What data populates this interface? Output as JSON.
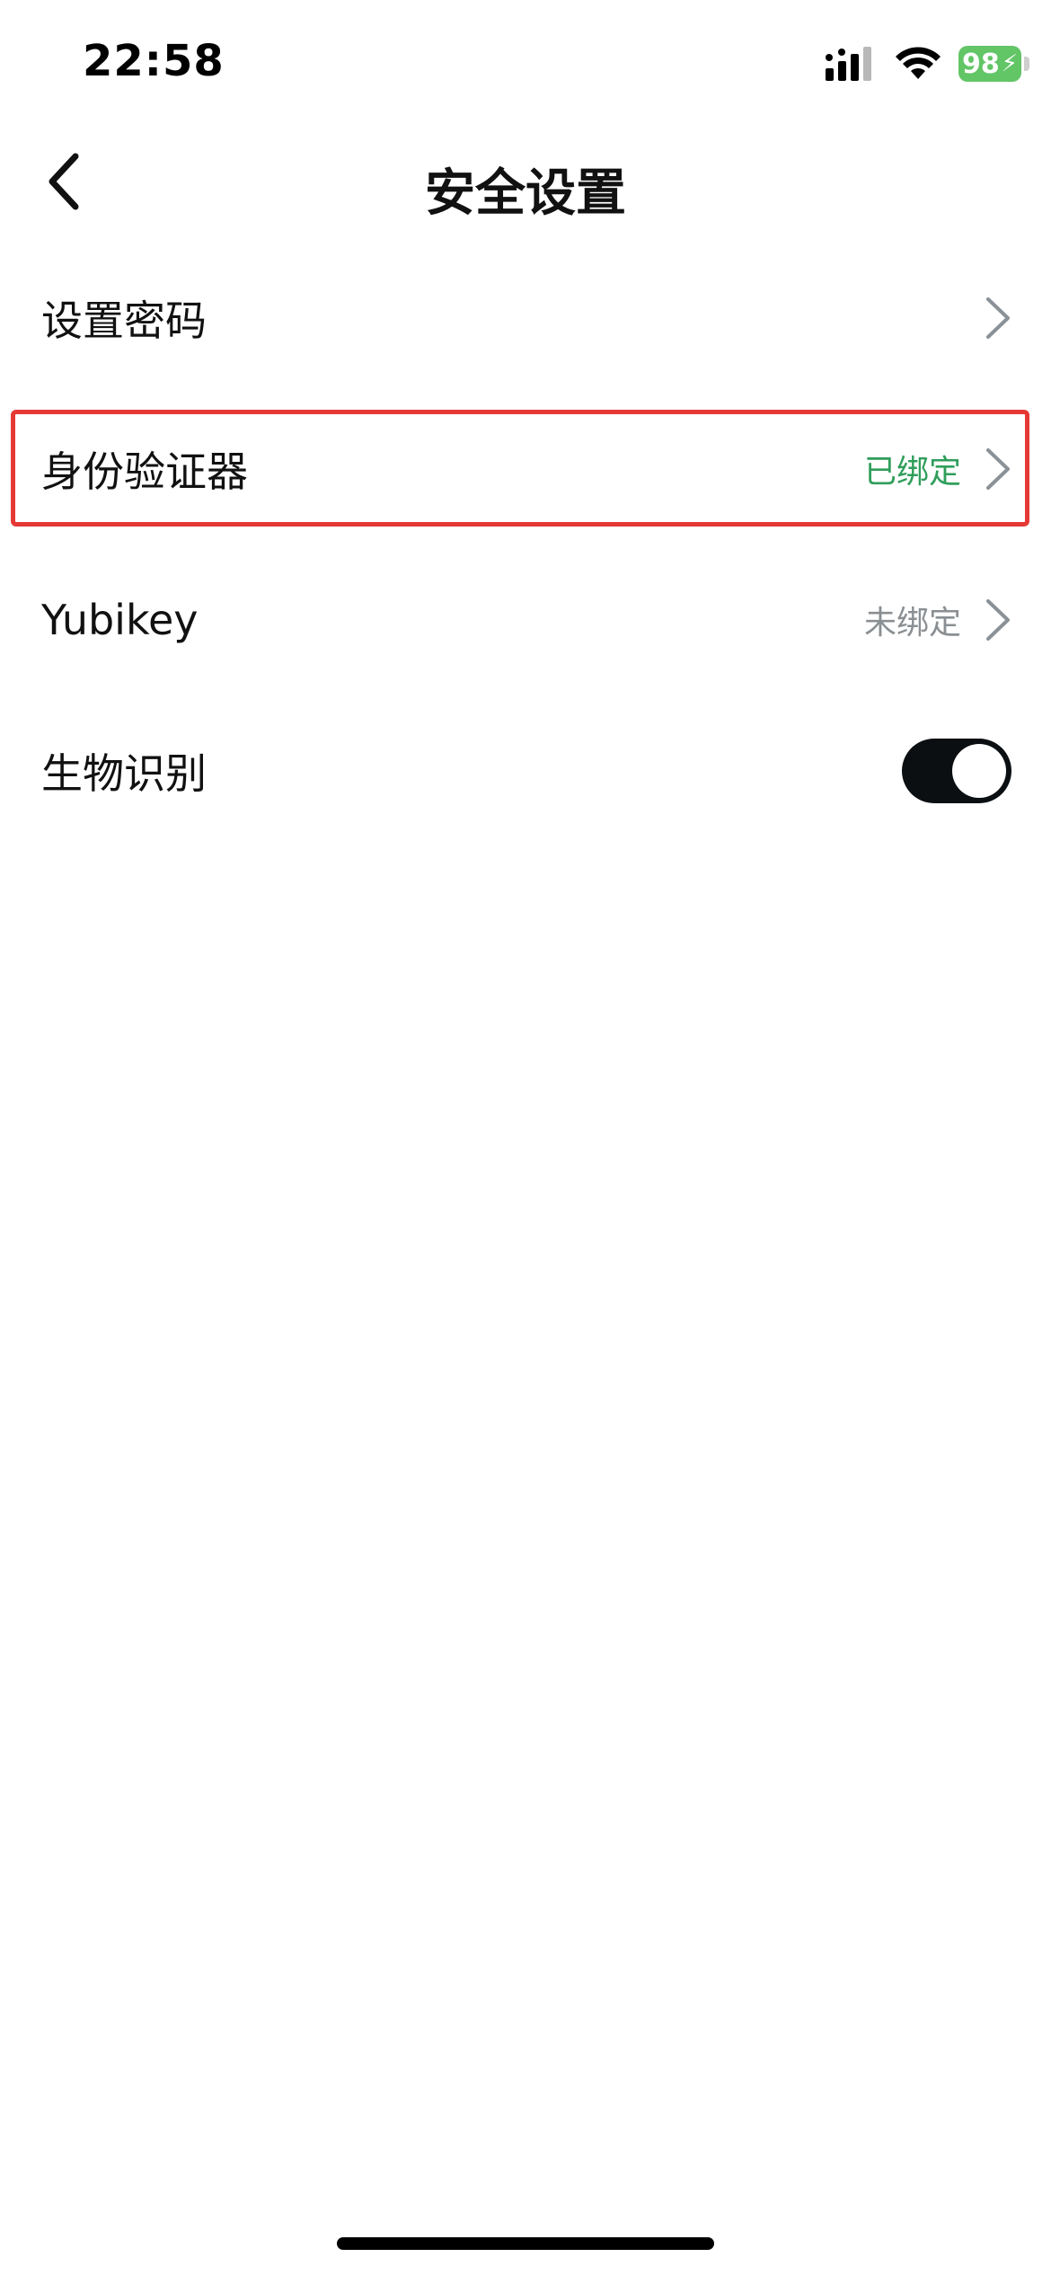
{
  "status_bar": {
    "time": "22:58",
    "battery_level": "98",
    "icons": [
      "signal-icon",
      "wifi-icon",
      "battery-icon",
      "charging-bolt-icon"
    ],
    "battery_color": "#62c566"
  },
  "nav": {
    "title": "安全设置",
    "back_icon": "chevron-left-icon"
  },
  "settings": {
    "items": [
      {
        "label": "设置密码"
      },
      {
        "label": "身份验证器",
        "status": "已绑定"
      },
      {
        "label": "Yubikey",
        "status": "未绑定"
      },
      {
        "label": "生物识别",
        "toggle_on": true
      }
    ]
  },
  "colors": {
    "status_bound": "#2f9e5b",
    "status_unbound": "#8a8f93",
    "highlight_border": "#e53935",
    "toggle_on": "#0b0f12"
  }
}
